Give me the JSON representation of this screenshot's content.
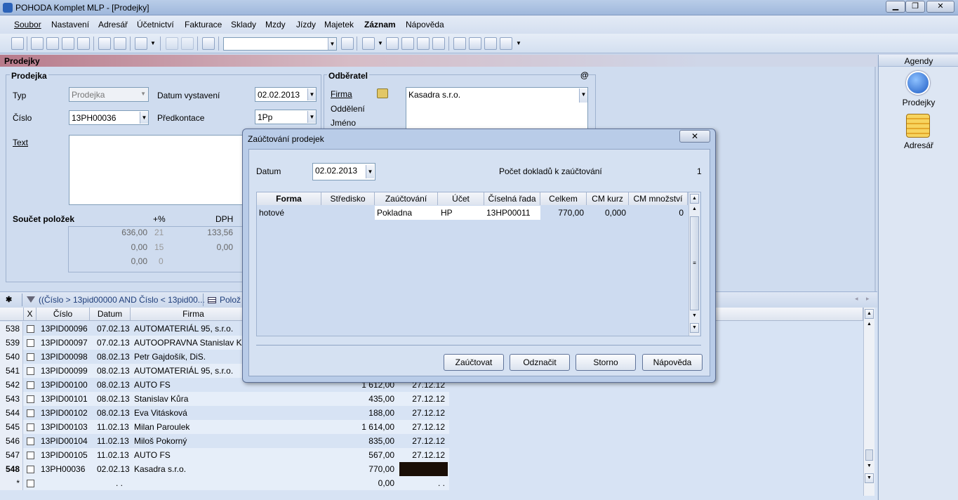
{
  "window": {
    "title": "POHODA Komplet MLP - [Prodejky]",
    "minimize": "▁",
    "restore": "❐",
    "close": "✕"
  },
  "menu": [
    "Soubor",
    "Nastavení",
    "Adresář",
    "Účetnictví",
    "Fakturace",
    "Sklady",
    "Mzdy",
    "Jízdy",
    "Majetek",
    "Záznam",
    "Nápověda"
  ],
  "section_title": "Prodejky",
  "form": {
    "group_prodejka": "Prodejka",
    "typ_label": "Typ",
    "typ_value": "Prodejka",
    "datum_label": "Datum vystavení",
    "datum_value": "02.02.2013",
    "cislo_label": "Číslo",
    "cislo_value": "13PH00036",
    "predkontace_label": "Předkontace",
    "predkontace_value": "1Pp",
    "text_label": "Text",
    "group_odberatel": "Odběratel",
    "at_sign": "@",
    "firma_label": "Firma",
    "oddeleni_label": "Oddělení",
    "jmeno_label": "Jméno",
    "firma_value": "Kasadra s.r.o.",
    "soucet_label": "Součet položek",
    "plus_pct": "+%",
    "dph_label": "DPH",
    "sum_rows": [
      {
        "base": "636,00",
        "rate": "21",
        "dph": "133,56"
      },
      {
        "base": "0,00",
        "rate": "15",
        "dph": "0,00"
      },
      {
        "base": "0,00",
        "rate": "0",
        "dph": ""
      }
    ]
  },
  "agenda": {
    "header": "Agendy",
    "items": [
      {
        "label": "Prodejky",
        "icon": "prodejky-icon"
      },
      {
        "label": "Adresář",
        "icon": "adresar-icon"
      }
    ]
  },
  "filter": {
    "star": "✱",
    "text": "((Číslo > 13pid00000 AND Číslo < 13pid00...",
    "polozky": "Polož"
  },
  "grid": {
    "headers": [
      "X",
      "Číslo",
      "Datum",
      "Firma"
    ],
    "rows": [
      {
        "n": "538",
        "cislo": "13PID00096",
        "datum": "07.02.13",
        "firma": "AUTOMATERIÁL 95, s.r.o.",
        "castka": "",
        "splat": ""
      },
      {
        "n": "539",
        "cislo": "13PID00097",
        "datum": "07.02.13",
        "firma": "AUTOOPRAVNA Stanislav Ko",
        "castka": "",
        "splat": ""
      },
      {
        "n": "540",
        "cislo": "13PID00098",
        "datum": "08.02.13",
        "firma": "Petr Gajdošík, DiS.",
        "castka": "",
        "splat": ""
      },
      {
        "n": "541",
        "cislo": "13PID00099",
        "datum": "08.02.13",
        "firma": "AUTOMATERIÁL 95, s.r.o.",
        "castka": "",
        "splat": ""
      },
      {
        "n": "542",
        "cislo": "13PID00100",
        "datum": "08.02.13",
        "firma": "AUTO FS",
        "castka": "1 612,00",
        "splat": "27.12.12"
      },
      {
        "n": "543",
        "cislo": "13PID00101",
        "datum": "08.02.13",
        "firma": "Stanislav Kůra",
        "castka": "435,00",
        "splat": "27.12.12"
      },
      {
        "n": "544",
        "cislo": "13PID00102",
        "datum": "08.02.13",
        "firma": "Eva Vitásková",
        "castka": "188,00",
        "splat": "27.12.12"
      },
      {
        "n": "545",
        "cislo": "13PID00103",
        "datum": "11.02.13",
        "firma": "Milan Paroulek",
        "castka": "1 614,00",
        "splat": "27.12.12"
      },
      {
        "n": "546",
        "cislo": "13PID00104",
        "datum": "11.02.13",
        "firma": "Miloš Pokorný",
        "castka": "835,00",
        "splat": "27.12.12"
      },
      {
        "n": "547",
        "cislo": "13PID00105",
        "datum": "11.02.13",
        "firma": "AUTO FS",
        "castka": "567,00",
        "splat": "27.12.12"
      },
      {
        "n": "548",
        "cislo": "13PH00036",
        "datum": "02.02.13",
        "firma": "Kasadra s.r.o.",
        "castka": "770,00",
        "splat": ""
      },
      {
        "n": "*",
        "cislo": "",
        "datum": ". .",
        "firma": "",
        "castka": "0,00",
        "splat": ". ."
      }
    ]
  },
  "modal": {
    "title": "Zaúčtování prodejek",
    "datum_label": "Datum",
    "datum_value": "02.02.2013",
    "count_label": "Počet dokladů k zaúčtování",
    "count_value": "1",
    "headers": [
      "Forma",
      "Středisko",
      "Zaúčtování",
      "Účet",
      "Číselná řada",
      "Celkem",
      "CM kurz",
      "CM množství"
    ],
    "row": {
      "forma": "hotové",
      "stredisko": "",
      "zauctovani": "Pokladna",
      "ucet": "HP",
      "rada": "13HP00011",
      "celkem": "770,00",
      "kurz": "0,000",
      "mnozstvi": "0"
    },
    "buttons": {
      "zauctovat": "Zaúčtovat",
      "odznacit": "Odznačit",
      "storno": "Storno",
      "napoveda": "Nápověda"
    }
  }
}
